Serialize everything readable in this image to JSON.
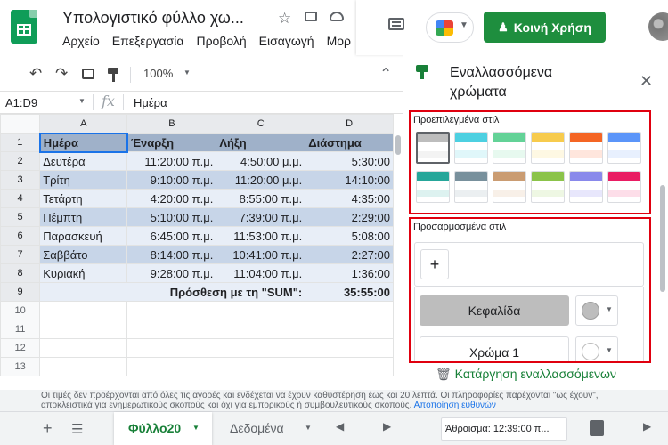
{
  "header": {
    "title": "Υπολογιστικό φύλλο χω...",
    "menu": [
      "Αρχείο",
      "Επεξεργασία",
      "Προβολή",
      "Εισαγωγή",
      "Μορ"
    ],
    "share_label": "Κοινή Χρήση"
  },
  "toolbar": {
    "zoom": "100%"
  },
  "formula_bar": {
    "range": "A1:D9",
    "fx": "fx",
    "value": "Ημέρα"
  },
  "grid": {
    "columns": [
      "A",
      "B",
      "C",
      "D"
    ],
    "rows": [
      "1",
      "2",
      "3",
      "4",
      "5",
      "6",
      "7",
      "8",
      "9",
      "10",
      "11",
      "12",
      "13"
    ],
    "header": [
      "Ημέρα",
      "Έναρξη",
      "Λήξη",
      "Διάστημα"
    ],
    "data": [
      [
        "Δευτέρα",
        "11:20:00 π.μ.",
        "4:50:00 μ.μ.",
        "5:30:00"
      ],
      [
        "Τρίτη",
        "9:10:00 π.μ.",
        "11:20:00 μ.μ.",
        "14:10:00"
      ],
      [
        "Τετάρτη",
        "4:20:00 π.μ.",
        "8:55:00 π.μ.",
        "4:35:00"
      ],
      [
        "Πέμπτη",
        "5:10:00 π.μ.",
        "7:39:00 π.μ.",
        "2:29:00"
      ],
      [
        "Παρασκευή",
        "6:45:00 π.μ.",
        "11:53:00 π.μ.",
        "5:08:00"
      ],
      [
        "Σαββάτο",
        "8:14:00 π.μ.",
        "10:41:00 π.μ.",
        "2:27:00"
      ],
      [
        "Κυριακή",
        "9:28:00 π.μ.",
        "11:04:00 π.μ.",
        "1:36:00"
      ]
    ],
    "sum_label": "Πρόσθεση με τη \"SUM\":",
    "sum_value": "35:55:00"
  },
  "panel": {
    "title_line1": "Εναλλασσόμενα",
    "title_line2": "χρώματα",
    "preset_label": "Προεπιλεγμένα στιλ",
    "presets": [
      {
        "header": "#bdbdbd",
        "band": "#f3f3f3"
      },
      {
        "header": "#4dd0e1",
        "band": "#e0f7fa"
      },
      {
        "header": "#63d297",
        "band": "#e7f9ef"
      },
      {
        "header": "#f7cb4d",
        "band": "#fef8e3"
      },
      {
        "header": "#f46524",
        "band": "#ffe6dd"
      },
      {
        "header": "#5b95f9",
        "band": "#e8f0fe"
      },
      {
        "header": "#26a69a",
        "band": "#ddf2f0"
      },
      {
        "header": "#78909c",
        "band": "#ebeff1"
      },
      {
        "header": "#ca9c72",
        "band": "#f8f0e8"
      },
      {
        "header": "#8bc34a",
        "band": "#eef7e3"
      },
      {
        "header": "#8989eb",
        "band": "#e8e7fc"
      },
      {
        "header": "#e91d63",
        "band": "#fddee9"
      }
    ],
    "custom_label": "Προσαρμοσμένα στιλ",
    "add_symbol": "+",
    "header_button": "Κεφαλίδα",
    "color1_button": "Χρώμα 1",
    "remove_label": "Κατάργηση εναλλασσόμενων"
  },
  "notice": {
    "text": "Οι τιμές δεν προέρχονται από όλες τις αγορές και ενδέχεται να έχουν καθυστέρηση έως και 20 λεπτά. Οι πληροφορίες παρέχονται \"ως έχουν\", αποκλειστικά για ενημερωτικούς σκοπούς και όχι για εμπορικούς ή συμβουλευτικούς σκοπούς.",
    "link": "Αποποίηση ευθυνών"
  },
  "tabs": {
    "active": "Φύλλο20",
    "other": "Δεδομένα",
    "sum_display": "Άθροισμα: 12:39:00 π..."
  },
  "colors": {
    "accent_green": "#1e8e3e",
    "sheet_tab": "#188038",
    "highlight_red": "#e0000f"
  }
}
